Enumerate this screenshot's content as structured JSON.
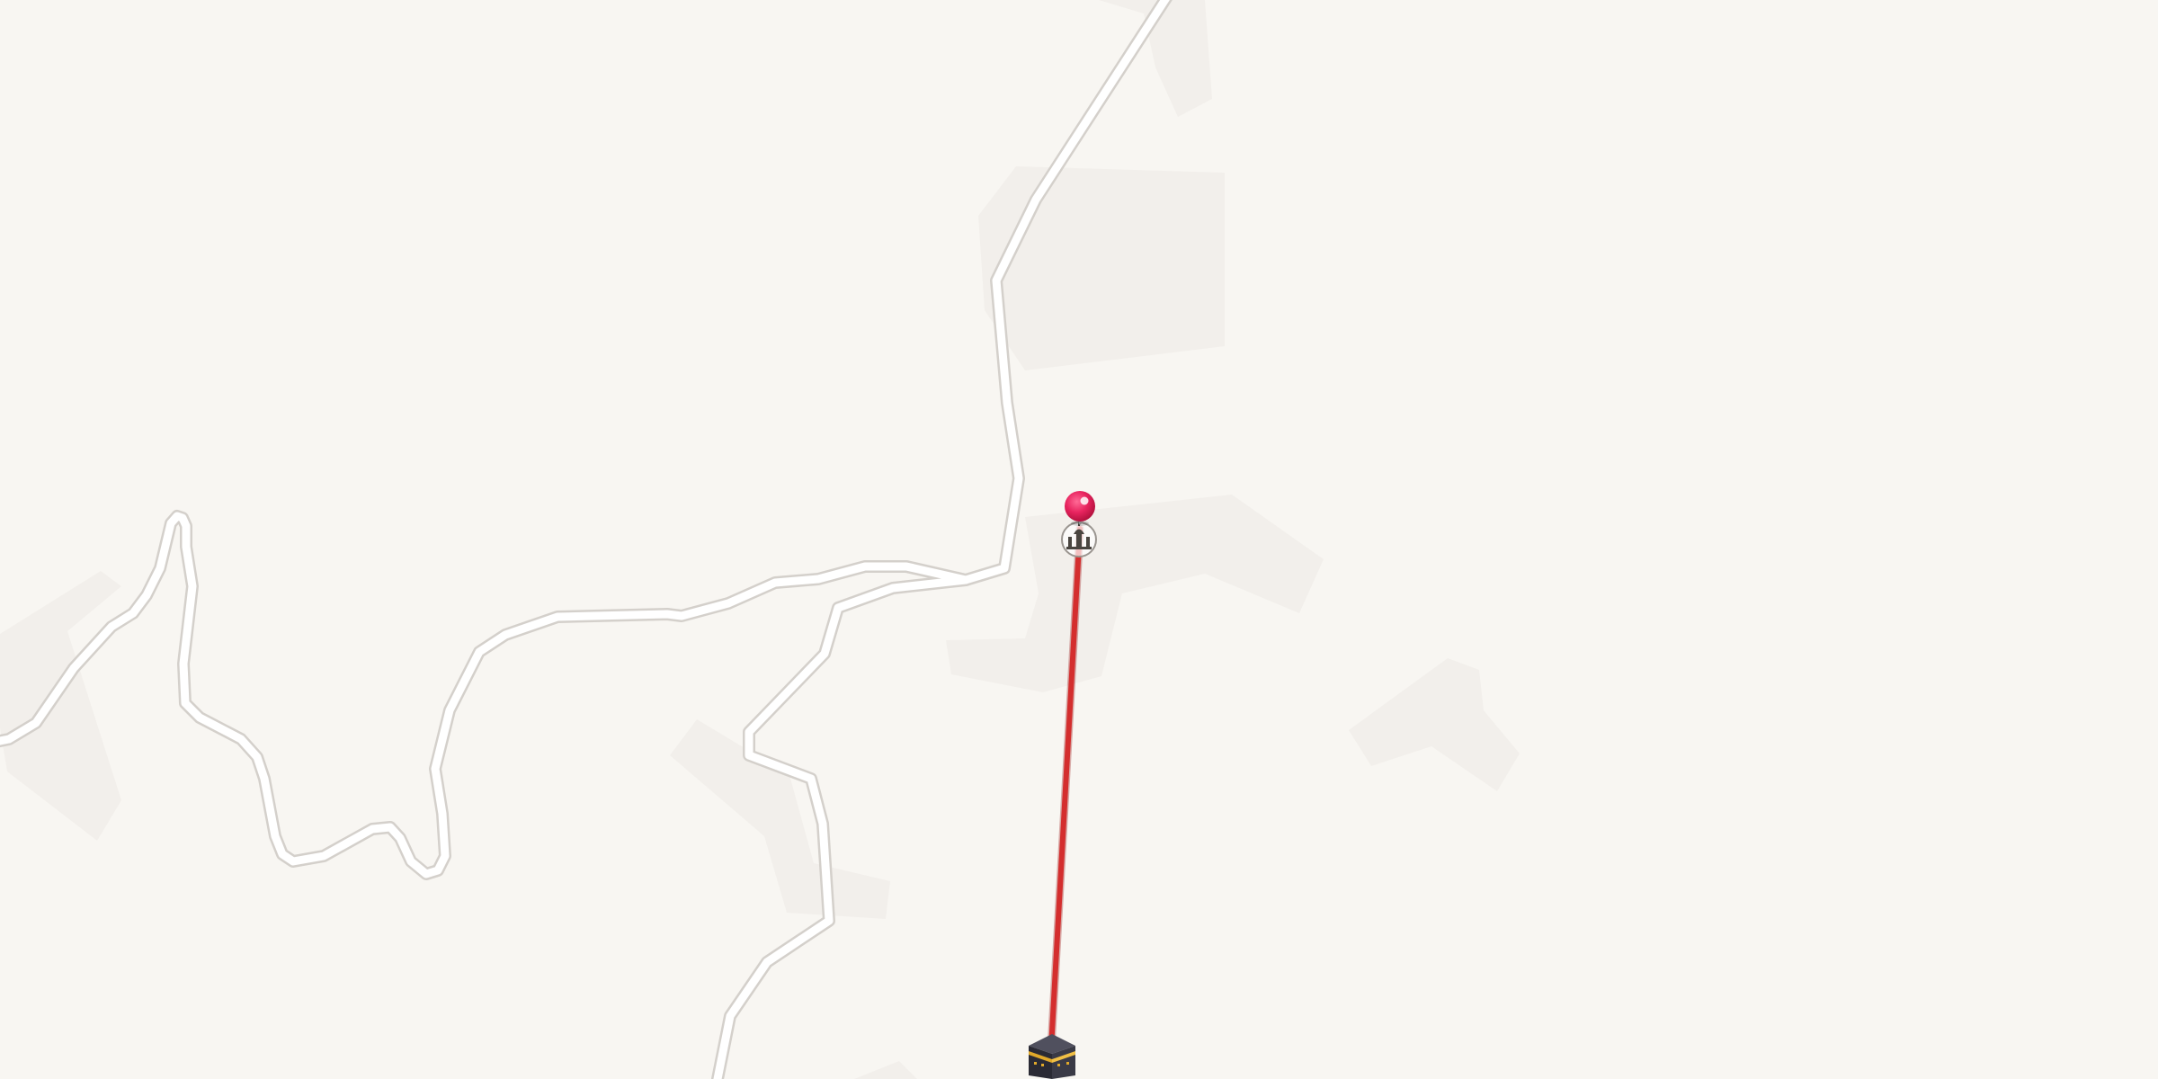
{
  "map": {
    "background_color": "#f8f6f2",
    "area_color": "#f2efeb",
    "road_casing_color": "#d4d0cb",
    "road_fill_color": "#ffffff",
    "qibla_line_color": "#d42e2e",
    "location_pin": {
      "icon": "map-pin-icon",
      "color": "#e8245f"
    },
    "mosque_marker": {
      "icon": "mosque-icon"
    },
    "kaaba_marker": {
      "icon": "kaaba-icon",
      "color": "#2e2e3a",
      "accent_color": "#e0a82a"
    }
  }
}
